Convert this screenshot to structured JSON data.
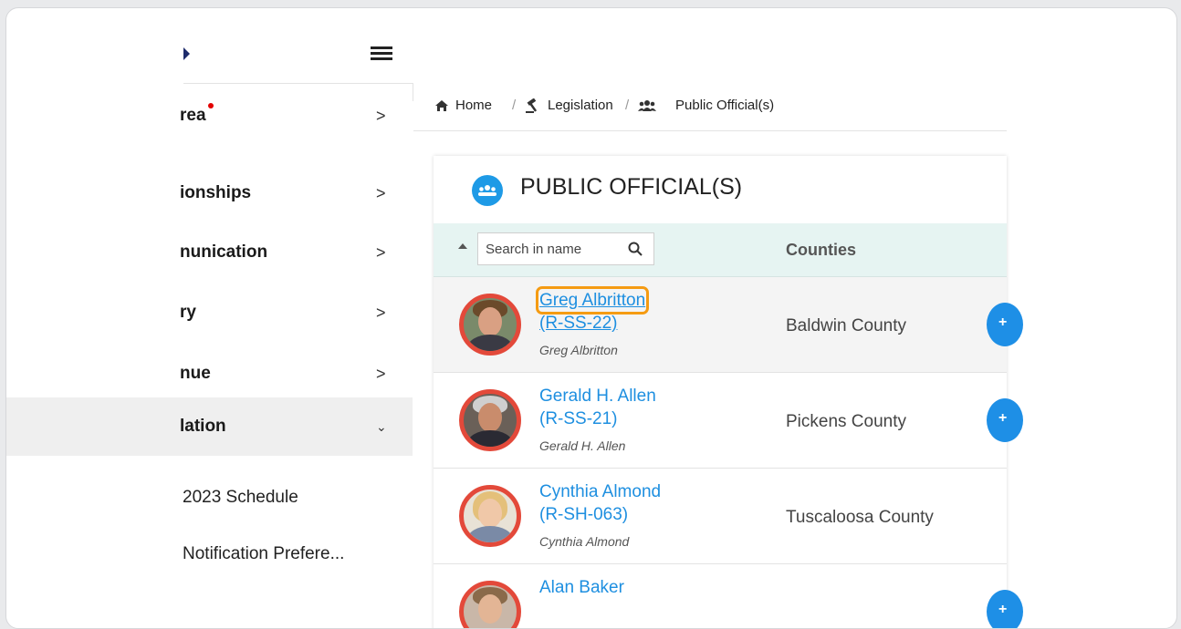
{
  "colors": {
    "accent": "#1e8fe0",
    "highlight": "#f59b12",
    "avatar_ring": "#e3493a",
    "table_header_bg": "#e6f4f2"
  },
  "sidebar": {
    "items": [
      {
        "label": "rea",
        "has_dot": true,
        "chevron": ">"
      },
      {
        "label": "ionships",
        "chevron": ">"
      },
      {
        "label": "nunication",
        "chevron": ">"
      },
      {
        "label": "ry",
        "chevron": ">"
      },
      {
        "label": "nue",
        "chevron": ">"
      },
      {
        "label": "lation",
        "chevron": "⌄",
        "active": true
      }
    ],
    "subitems": [
      {
        "label": "2023 Schedule"
      },
      {
        "label": "Notification Prefere..."
      }
    ]
  },
  "breadcrumb": {
    "home": "Home",
    "legislation": "Legislation",
    "current": "Public Official(s)",
    "sep": "/"
  },
  "card": {
    "title": "PUBLIC OFFICIAL(S)",
    "search_placeholder": "Search in name",
    "col_counties": "Counties"
  },
  "rows": [
    {
      "name": "Greg Albritton",
      "district": "(R-SS-22)",
      "subname": "Greg Albritton",
      "county": "Baldwin County",
      "action": "+"
    },
    {
      "name": "Gerald H. Allen",
      "district": "(R-SS-21)",
      "subname": "Gerald H. Allen",
      "county": "Pickens County",
      "action": "+"
    },
    {
      "name": "Cynthia Almond",
      "district": "(R-SH-063)",
      "subname": "Cynthia Almond",
      "county": "Tuscaloosa County"
    },
    {
      "name": "Alan Baker",
      "action": "+"
    }
  ]
}
